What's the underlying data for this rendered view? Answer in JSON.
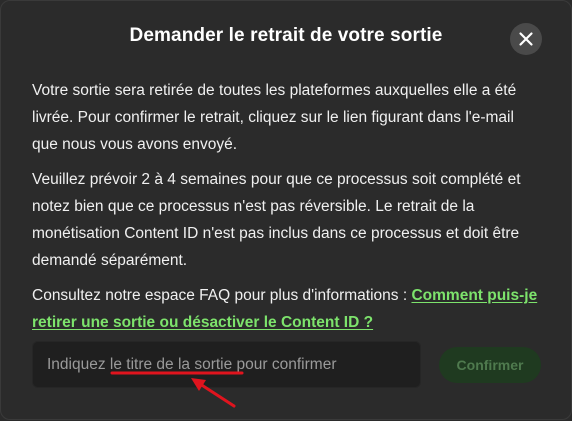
{
  "modal": {
    "title": "Demander le retrait de votre sortie",
    "close_icon": "close-icon",
    "paragraph1": "Votre sortie sera retirée de toutes les plateformes auxquelles elle a été livrée. Pour confirmer le retrait, cliquez sur le lien figurant dans l'e-mail que nous vous avons envoyé.",
    "paragraph2": "Veuillez prévoir 2 à 4 semaines pour que ce processus soit complété et notez bien que ce processus n'est pas réversible. Le retrait de la monétisation Content ID n'est pas inclus dans ce processus et doit être demandé séparément.",
    "paragraph3_prefix": "Consultez notre espace FAQ pour plus d'informations : ",
    "faq_link": "Comment puis-je retirer une sortie ou désactiver le Content ID ?",
    "input": {
      "value": "",
      "placeholder": "Indiquez le titre de la sortie pour confirmer"
    },
    "confirm_label": "Confirmer"
  },
  "colors": {
    "background": "#2b2b2b",
    "link": "#7de36c",
    "button_bg": "#1f3a20",
    "button_text": "#4f7a4e",
    "annotation": "#e0141e"
  }
}
